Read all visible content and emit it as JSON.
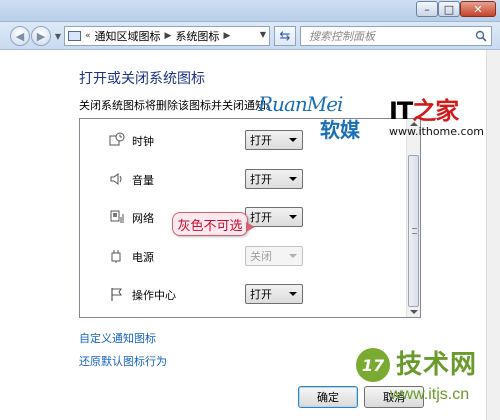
{
  "window": {
    "controls": {
      "min": "–",
      "max": "□",
      "close": "✕"
    }
  },
  "navbar": {
    "breadcrumb_prefix": "«",
    "breadcrumbs": [
      "通知区域图标",
      "系统图标"
    ],
    "search_placeholder": "搜索控制面板"
  },
  "main": {
    "title": "打开或关闭系统图标",
    "description": "关闭系统图标将删除该图标并关闭通知。",
    "items": [
      {
        "label": "时钟",
        "icon": "clock-icon",
        "value": "打开",
        "enabled": true
      },
      {
        "label": "音量",
        "icon": "volume-icon",
        "value": "打开",
        "enabled": true
      },
      {
        "label": "网络",
        "icon": "network-icon",
        "value": "打开",
        "enabled": true
      },
      {
        "label": "电源",
        "icon": "power-icon",
        "value": "关闭",
        "enabled": false
      },
      {
        "label": "操作中心",
        "icon": "flag-icon",
        "value": "打开",
        "enabled": true
      }
    ],
    "callout": "灰色不可选",
    "links": {
      "customize": "自定义通知图标",
      "restore": "还原默认图标行为"
    },
    "buttons": {
      "ok": "确定",
      "cancel": "取消"
    }
  },
  "watermarks": {
    "ruanmei_en": "RuanMei",
    "ruanmei_cn": "软媒",
    "ithome_logo_a": "IT",
    "ithome_logo_b": "之家",
    "ithome_url": "www.ithome.com",
    "itjs_badge": "17",
    "itjs_cn": "技术网",
    "itjs_url": "www.itjs.cn"
  },
  "colors": {
    "title": "#1e3287",
    "link": "#1563c0",
    "callout_text": "#c40c2c",
    "ruanmei": "#1b6fb4",
    "itjs": "#6a9a2b"
  }
}
